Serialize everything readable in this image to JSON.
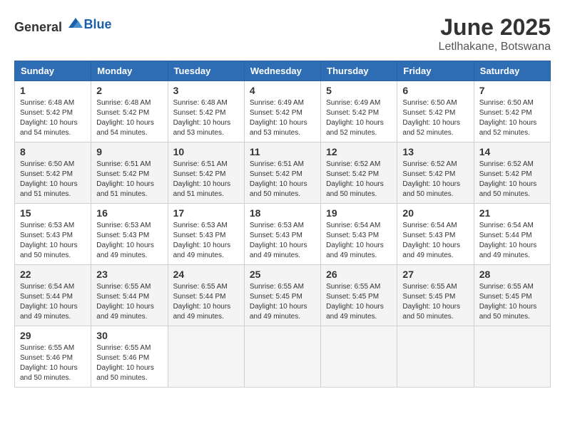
{
  "header": {
    "logo_general": "General",
    "logo_blue": "Blue",
    "month": "June 2025",
    "location": "Letlhakane, Botswana"
  },
  "weekdays": [
    "Sunday",
    "Monday",
    "Tuesday",
    "Wednesday",
    "Thursday",
    "Friday",
    "Saturday"
  ],
  "weeks": [
    [
      {
        "day": "1",
        "sunrise": "6:48 AM",
        "sunset": "5:42 PM",
        "daylight": "10 hours and 54 minutes."
      },
      {
        "day": "2",
        "sunrise": "6:48 AM",
        "sunset": "5:42 PM",
        "daylight": "10 hours and 54 minutes."
      },
      {
        "day": "3",
        "sunrise": "6:48 AM",
        "sunset": "5:42 PM",
        "daylight": "10 hours and 53 minutes."
      },
      {
        "day": "4",
        "sunrise": "6:49 AM",
        "sunset": "5:42 PM",
        "daylight": "10 hours and 53 minutes."
      },
      {
        "day": "5",
        "sunrise": "6:49 AM",
        "sunset": "5:42 PM",
        "daylight": "10 hours and 52 minutes."
      },
      {
        "day": "6",
        "sunrise": "6:50 AM",
        "sunset": "5:42 PM",
        "daylight": "10 hours and 52 minutes."
      },
      {
        "day": "7",
        "sunrise": "6:50 AM",
        "sunset": "5:42 PM",
        "daylight": "10 hours and 52 minutes."
      }
    ],
    [
      {
        "day": "8",
        "sunrise": "6:50 AM",
        "sunset": "5:42 PM",
        "daylight": "10 hours and 51 minutes."
      },
      {
        "day": "9",
        "sunrise": "6:51 AM",
        "sunset": "5:42 PM",
        "daylight": "10 hours and 51 minutes."
      },
      {
        "day": "10",
        "sunrise": "6:51 AM",
        "sunset": "5:42 PM",
        "daylight": "10 hours and 51 minutes."
      },
      {
        "day": "11",
        "sunrise": "6:51 AM",
        "sunset": "5:42 PM",
        "daylight": "10 hours and 50 minutes."
      },
      {
        "day": "12",
        "sunrise": "6:52 AM",
        "sunset": "5:42 PM",
        "daylight": "10 hours and 50 minutes."
      },
      {
        "day": "13",
        "sunrise": "6:52 AM",
        "sunset": "5:42 PM",
        "daylight": "10 hours and 50 minutes."
      },
      {
        "day": "14",
        "sunrise": "6:52 AM",
        "sunset": "5:42 PM",
        "daylight": "10 hours and 50 minutes."
      }
    ],
    [
      {
        "day": "15",
        "sunrise": "6:53 AM",
        "sunset": "5:43 PM",
        "daylight": "10 hours and 50 minutes."
      },
      {
        "day": "16",
        "sunrise": "6:53 AM",
        "sunset": "5:43 PM",
        "daylight": "10 hours and 49 minutes."
      },
      {
        "day": "17",
        "sunrise": "6:53 AM",
        "sunset": "5:43 PM",
        "daylight": "10 hours and 49 minutes."
      },
      {
        "day": "18",
        "sunrise": "6:53 AM",
        "sunset": "5:43 PM",
        "daylight": "10 hours and 49 minutes."
      },
      {
        "day": "19",
        "sunrise": "6:54 AM",
        "sunset": "5:43 PM",
        "daylight": "10 hours and 49 minutes."
      },
      {
        "day": "20",
        "sunrise": "6:54 AM",
        "sunset": "5:43 PM",
        "daylight": "10 hours and 49 minutes."
      },
      {
        "day": "21",
        "sunrise": "6:54 AM",
        "sunset": "5:44 PM",
        "daylight": "10 hours and 49 minutes."
      }
    ],
    [
      {
        "day": "22",
        "sunrise": "6:54 AM",
        "sunset": "5:44 PM",
        "daylight": "10 hours and 49 minutes."
      },
      {
        "day": "23",
        "sunrise": "6:55 AM",
        "sunset": "5:44 PM",
        "daylight": "10 hours and 49 minutes."
      },
      {
        "day": "24",
        "sunrise": "6:55 AM",
        "sunset": "5:44 PM",
        "daylight": "10 hours and 49 minutes."
      },
      {
        "day": "25",
        "sunrise": "6:55 AM",
        "sunset": "5:45 PM",
        "daylight": "10 hours and 49 minutes."
      },
      {
        "day": "26",
        "sunrise": "6:55 AM",
        "sunset": "5:45 PM",
        "daylight": "10 hours and 49 minutes."
      },
      {
        "day": "27",
        "sunrise": "6:55 AM",
        "sunset": "5:45 PM",
        "daylight": "10 hours and 50 minutes."
      },
      {
        "day": "28",
        "sunrise": "6:55 AM",
        "sunset": "5:45 PM",
        "daylight": "10 hours and 50 minutes."
      }
    ],
    [
      {
        "day": "29",
        "sunrise": "6:55 AM",
        "sunset": "5:46 PM",
        "daylight": "10 hours and 50 minutes."
      },
      {
        "day": "30",
        "sunrise": "6:55 AM",
        "sunset": "5:46 PM",
        "daylight": "10 hours and 50 minutes."
      },
      null,
      null,
      null,
      null,
      null
    ]
  ],
  "labels": {
    "sunrise": "Sunrise:",
    "sunset": "Sunset:",
    "daylight": "Daylight:"
  }
}
